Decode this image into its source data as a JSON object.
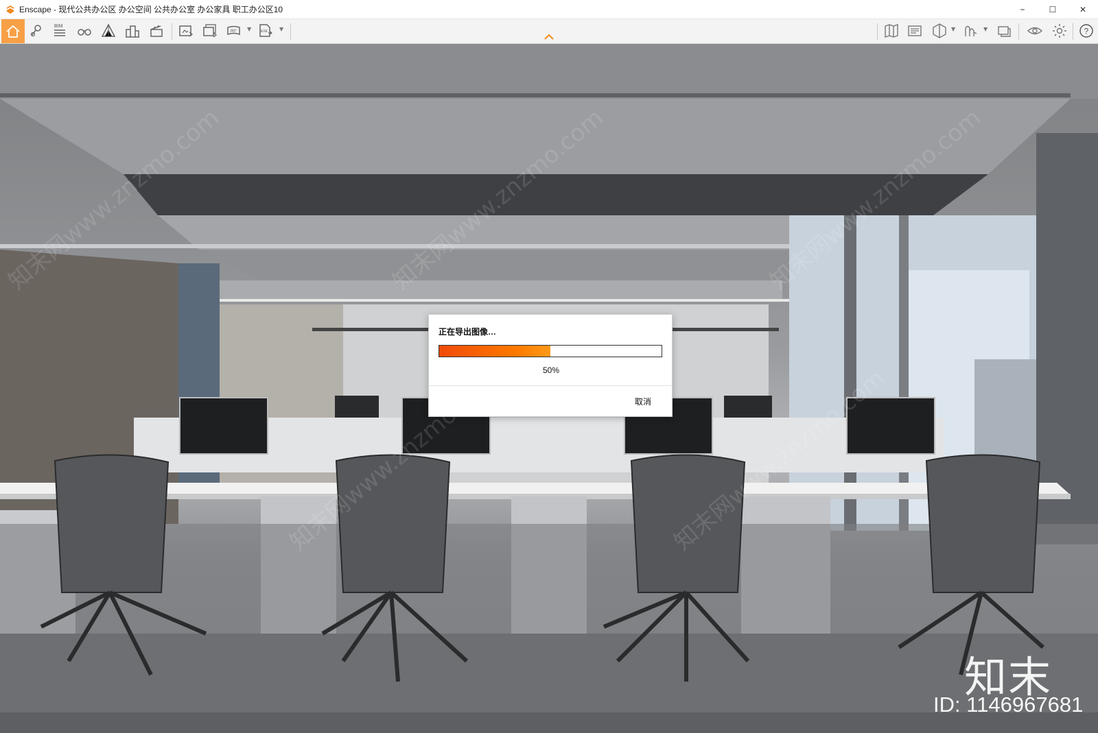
{
  "window": {
    "title": "Enscape - 现代公共办公区 办公空间 公共办公室 办公家具 职工办公区10",
    "minimize": "–",
    "maximize": "☐",
    "close": "✕"
  },
  "toolbar": {
    "bim_label": "BIM",
    "accent_color": "#f7a046",
    "buttons_left": [
      "home-icon",
      "location-pin-icon",
      "bim-icon",
      "binoculars-icon",
      "perspective-icon",
      "buildings-icon",
      "clapperboard-icon",
      "screenshot-icon",
      "batch-render-icon",
      "panorama-360-icon",
      "exe-export-icon"
    ],
    "buttons_right": [
      "map-icon",
      "gallery-icon",
      "cube-icon",
      "sound-icon",
      "sync-icon",
      "eye-icon",
      "gear-icon",
      "help-icon"
    ]
  },
  "dialog": {
    "title": "正在导出图像…",
    "progress": 0.5,
    "progress_text": "50%",
    "cancel_label": "取消",
    "progress_color": "#ff6a00"
  },
  "watermark": {
    "brand": "知末",
    "id": "ID: 1146967681",
    "diagonal": "知末网www.znzmo.com"
  }
}
